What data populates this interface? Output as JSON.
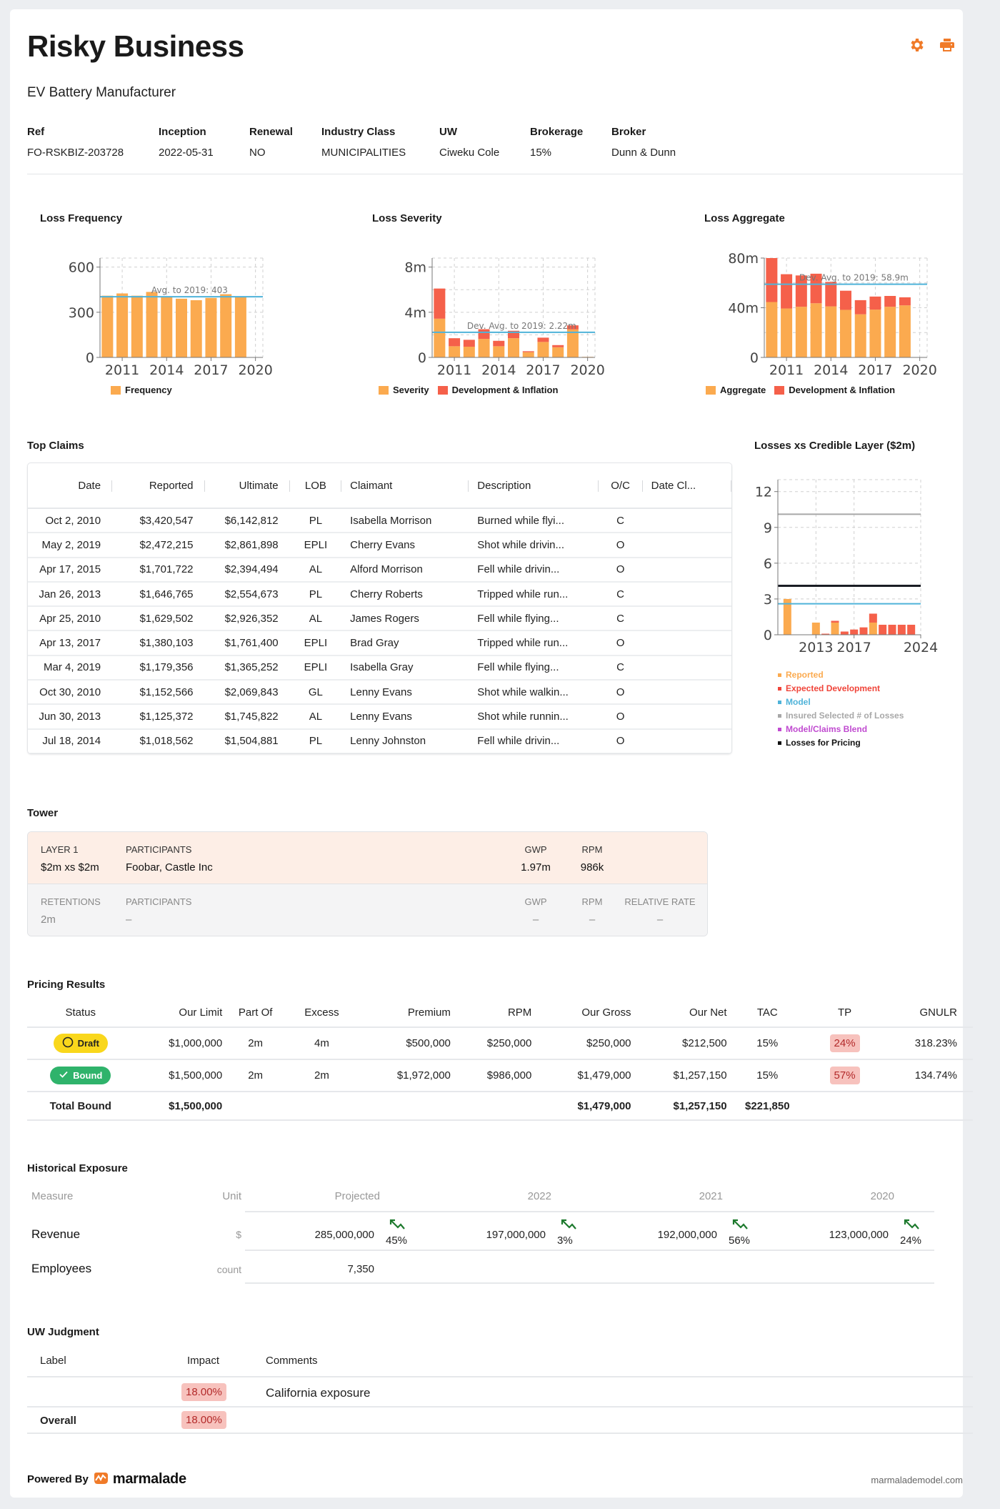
{
  "header": {
    "title": "Risky Business",
    "subtitle": "EV Battery Manufacturer",
    "icons": [
      "gear-icon",
      "printer-icon"
    ],
    "accent_color": "#f07a28"
  },
  "meta": [
    {
      "label": "Ref",
      "value": "FO-RSKBIZ-203728"
    },
    {
      "label": "Inception",
      "value": "2022-05-31"
    },
    {
      "label": "Renewal",
      "value": "NO"
    },
    {
      "label": "Industry Class",
      "value": "MUNICIPALITIES"
    },
    {
      "label": "UW",
      "value": "Ciweku Cole"
    },
    {
      "label": "Brokerage",
      "value": "15%"
    },
    {
      "label": "Broker",
      "value": "Dunn & Dunn"
    }
  ],
  "chart_data": [
    {
      "id": "loss-frequency",
      "type": "bar",
      "title": "Loss Frequency",
      "x": [
        2010,
        2011,
        2012,
        2013,
        2014,
        2015,
        2016,
        2017,
        2018,
        2019
      ],
      "xticks": [
        2011,
        2014,
        2017,
        2020
      ],
      "xlim": [
        2009.5,
        2020.5
      ],
      "ylim": [
        0,
        660
      ],
      "yticks": [
        0,
        300,
        600
      ],
      "ytick_labels": [
        "0",
        "300",
        "600"
      ],
      "series": [
        {
          "name": "Frequency",
          "color": "#fbaa4f",
          "values": [
            410,
            425,
            410,
            435,
            405,
            390,
            380,
            395,
            420,
            405
          ]
        }
      ],
      "reference_line": {
        "label": "Avg. to 2019: 403",
        "value": 403,
        "color": "#4fb3d9"
      },
      "grid": true,
      "legend": "bottom"
    },
    {
      "id": "loss-severity",
      "type": "bar",
      "stacked": true,
      "title": "Loss Severity",
      "x": [
        2010,
        2011,
        2012,
        2013,
        2014,
        2015,
        2016,
        2017,
        2018,
        2019,
        2020
      ],
      "xticks": [
        2011,
        2014,
        2017,
        2020
      ],
      "xlim": [
        2009.5,
        2020.5
      ],
      "ylim": [
        0,
        8.8
      ],
      "yticks": [
        0,
        4,
        8
      ],
      "ytick_labels": [
        "0",
        "4m",
        "8m"
      ],
      "unit": "m",
      "series": [
        {
          "name": "Severity",
          "color": "#fbaa4f",
          "values": [
            3.43,
            0.99,
            0.95,
            1.64,
            0.99,
            1.7,
            0.46,
            1.37,
            0.9,
            2.48,
            0.05
          ]
        },
        {
          "name": "Development & Inflation",
          "color": "#f5604a",
          "values": [
            2.67,
            0.71,
            0.61,
            0.86,
            0.48,
            0.66,
            0.09,
            0.38,
            0.19,
            0.36,
            0.0
          ]
        }
      ],
      "reference_line": {
        "label": "Dev. Avg. to 2019: 2.22m",
        "value": 2.22,
        "color": "#4fb3d9"
      },
      "grid": true,
      "legend": "bottom"
    },
    {
      "id": "loss-aggregate",
      "type": "bar",
      "stacked": true,
      "title": "Loss Aggregate",
      "x": [
        2010,
        2011,
        2012,
        2013,
        2014,
        2015,
        2016,
        2017,
        2018,
        2019
      ],
      "xticks": [
        2011,
        2014,
        2017,
        2020
      ],
      "xlim": [
        2009.5,
        2020.5
      ],
      "ylim": [
        0,
        80
      ],
      "yticks": [
        0,
        40,
        80
      ],
      "ytick_labels": [
        "0",
        "40m",
        "80m"
      ],
      "unit": "m",
      "series": [
        {
          "name": "Aggregate",
          "color": "#fbaa4f",
          "values": [
            44.6,
            39.4,
            40.8,
            43.6,
            41.1,
            38.3,
            34.7,
            38.5,
            40.8,
            41.9
          ]
        },
        {
          "name": "Development & Inflation",
          "color": "#f5604a",
          "values": [
            35.4,
            27.6,
            25.2,
            23.8,
            19.7,
            15.4,
            11.4,
            10.5,
            8.7,
            6.5
          ]
        }
      ],
      "reference_line": {
        "label": "Dev. Avg. to 2019: 58.9m",
        "value": 58.9,
        "color": "#4fb3d9"
      },
      "grid": true,
      "legend": "bottom"
    },
    {
      "id": "losses-xs-credible-layer",
      "type": "bar",
      "stacked": true,
      "title": "Losses xs Credible Layer ($2m)",
      "x": [
        2010,
        2011,
        2012,
        2013,
        2014,
        2015,
        2016,
        2017,
        2018,
        2019,
        2020,
        2021,
        2022,
        2023
      ],
      "xticks": [
        2013,
        2017,
        2024
      ],
      "xlim": [
        2009,
        2024
      ],
      "ylim": [
        0,
        13
      ],
      "yticks": [
        0,
        3,
        6,
        9,
        12
      ],
      "ytick_labels": [
        "0",
        "3",
        "6",
        "9",
        "12"
      ],
      "series": [
        {
          "name": "Reported",
          "color": "#fbaa4f",
          "values": [
            3.0,
            0,
            0,
            1.02,
            0,
            1.02,
            0,
            0,
            0,
            1.02,
            0,
            0,
            0,
            0
          ]
        },
        {
          "name": "Expected Development",
          "color": "#f5604a",
          "values": [
            0,
            0,
            0,
            0,
            0.09,
            0.15,
            0.27,
            0.44,
            0.62,
            0.75,
            0.84,
            0.84,
            0.84,
            0.84
          ]
        }
      ],
      "lines": [
        {
          "name": "Model",
          "value": 2.6,
          "color": "#4fb3d9"
        },
        {
          "name": "Insured Selected # of Losses",
          "value": 10.1,
          "color": "#a8a8a8"
        },
        {
          "name": "Losses for Pricing",
          "value": 4.1,
          "color": "#1a1d24"
        }
      ],
      "legend_entries": [
        {
          "name": "Reported",
          "color": "#fbaa4f"
        },
        {
          "name": "Expected Development",
          "color": "#f0453a"
        },
        {
          "name": "Model",
          "color": "#4fb3d9"
        },
        {
          "name": "Insured Selected # of Losses",
          "color": "#a8a8a8"
        },
        {
          "name": "Model/Claims Blend",
          "color": "#c04ad0"
        },
        {
          "name": "Losses for Pricing",
          "color": "#111111"
        }
      ],
      "grid": true,
      "legend": "bottom"
    }
  ],
  "top_claims": {
    "title": "Top Claims",
    "columns": [
      "Date",
      "Reported",
      "Ultimate",
      "LOB",
      "Claimant",
      "Description",
      "O/C",
      "Date Cl..."
    ],
    "rows": [
      [
        "Oct 2, 2010",
        "$3,420,547",
        "$6,142,812",
        "PL",
        "Isabella Morrison",
        "Burned while flyi...",
        "C",
        ""
      ],
      [
        "May 2, 2019",
        "$2,472,215",
        "$2,861,898",
        "EPLI",
        "Cherry Evans",
        "Shot while drivin...",
        "O",
        ""
      ],
      [
        "Apr 17, 2015",
        "$1,701,722",
        "$2,394,494",
        "AL",
        "Alford Morrison",
        "Fell while drivin...",
        "O",
        ""
      ],
      [
        "Jan 26, 2013",
        "$1,646,765",
        "$2,554,673",
        "PL",
        "Cherry Roberts",
        "Tripped while run...",
        "C",
        ""
      ],
      [
        "Apr 25, 2010",
        "$1,629,502",
        "$2,926,352",
        "AL",
        "James Rogers",
        "Fell while flying...",
        "C",
        ""
      ],
      [
        "Apr 13, 2017",
        "$1,380,103",
        "$1,761,400",
        "EPLI",
        "Brad Gray",
        "Tripped while run...",
        "O",
        ""
      ],
      [
        "Mar 4, 2019",
        "$1,179,356",
        "$1,365,252",
        "EPLI",
        "Isabella Gray",
        "Fell while flying...",
        "C",
        ""
      ],
      [
        "Oct 30, 2010",
        "$1,152,566",
        "$2,069,843",
        "GL",
        "Lenny Evans",
        "Shot while walkin...",
        "O",
        ""
      ],
      [
        "Jun 30, 2013",
        "$1,125,372",
        "$1,745,822",
        "AL",
        "Lenny Evans",
        "Shot while runnin...",
        "O",
        ""
      ],
      [
        "Jul 18, 2014",
        "$1,018,562",
        "$1,504,881",
        "PL",
        "Lenny Johnston",
        "Fell while drivin...",
        "O",
        ""
      ]
    ]
  },
  "tower": {
    "title": "Tower",
    "layer": {
      "layer_label": "LAYER 1",
      "layer_value": "$2m xs $2m",
      "participants_label": "PARTICIPANTS",
      "participants_value": "Foobar, Castle Inc",
      "gwp_label": "GWP",
      "gwp_value": "1.97m",
      "rpm_label": "RPM",
      "rpm_value": "986k"
    },
    "retentions": {
      "retentions_label": "RETENTIONS",
      "retentions_value": "2m",
      "participants_label": "PARTICIPANTS",
      "participants_value": "–",
      "gwp_label": "GWP",
      "gwp_value": "–",
      "rpm_label": "RPM",
      "rpm_value": "–",
      "rel_label": "RELATIVE RATE",
      "rel_value": "–"
    }
  },
  "pricing": {
    "title": "Pricing Results",
    "columns": [
      "Status",
      "Our Limit",
      "Part Of",
      "Excess",
      "Premium",
      "RPM",
      "Our Gross",
      "Our Net",
      "TAC",
      "TP",
      "GNULR"
    ],
    "rows": [
      {
        "status": "Draft",
        "status_icon": "circle-icon",
        "our_limit": "$1,000,000",
        "part_of": "2m",
        "excess": "4m",
        "premium": "$500,000",
        "rpm": "$250,000",
        "our_gross": "$250,000",
        "our_net": "$212,500",
        "tac": "15%",
        "tp": "24%",
        "gnulr": "318.23%"
      },
      {
        "status": "Bound",
        "status_icon": "check-icon",
        "our_limit": "$1,500,000",
        "part_of": "2m",
        "excess": "2m",
        "premium": "$1,972,000",
        "rpm": "$986,000",
        "our_gross": "$1,479,000",
        "our_net": "$1,257,150",
        "tac": "15%",
        "tp": "57%",
        "gnulr": "134.74%"
      }
    ],
    "total": {
      "label": "Total Bound",
      "our_limit": "$1,500,000",
      "our_gross": "$1,479,000",
      "our_net": "$1,257,150",
      "tac": "$221,850"
    }
  },
  "historical": {
    "title": "Historical Exposure",
    "columns": [
      "Measure",
      "Unit",
      "Projected",
      "2022",
      "2021",
      "2020"
    ],
    "revenue": {
      "measure": "Revenue",
      "unit": "$",
      "values": [
        "285,000,000",
        "197,000,000",
        "192,000,000",
        "123,000,000"
      ],
      "changes": [
        "45%",
        "3%",
        "56%",
        "24%"
      ]
    },
    "employees": {
      "measure": "Employees",
      "unit": "count",
      "values": [
        "7,350"
      ]
    }
  },
  "uw_judgment": {
    "title": "UW Judgment",
    "columns": [
      "Label",
      "Impact",
      "Comments"
    ],
    "rows": [
      {
        "label": "",
        "impact": "18.00%",
        "comment": "California exposure"
      }
    ],
    "overall": {
      "label": "Overall",
      "impact": "18.00%"
    }
  },
  "footer": {
    "powered_by": "Powered By",
    "brand": "marmalade",
    "site": "marmalademodel.com"
  }
}
